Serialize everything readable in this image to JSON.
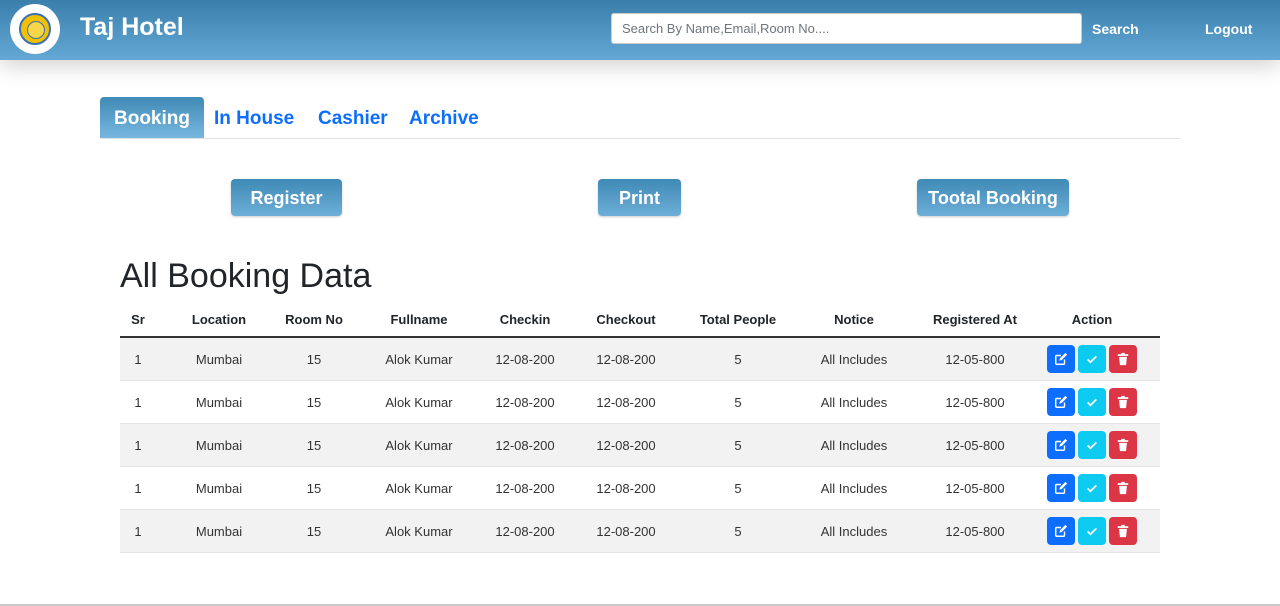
{
  "header": {
    "brand": "Taj Hotel",
    "search_placeholder": "Search By Name,Email,Room No....",
    "search_label": "Search",
    "logout_label": "Logout"
  },
  "tabs": [
    {
      "label": "Booking",
      "active": true
    },
    {
      "label": "In House",
      "active": false
    },
    {
      "label": "Cashier",
      "active": false
    },
    {
      "label": "Archive",
      "active": false
    }
  ],
  "actions": {
    "register": "Register",
    "print": "Print",
    "total": "Tootal Booking"
  },
  "heading": "All Booking Data",
  "table": {
    "columns": [
      "Sr",
      "Location",
      "Room No",
      "Fullname",
      "Checkin",
      "Checkout",
      "Total People",
      "Notice",
      "Registered At",
      "Action"
    ],
    "rows": [
      [
        "1",
        "Mumbai",
        "15",
        "Alok Kumar",
        "12-08-200",
        "12-08-200",
        "5",
        "All Includes",
        "12-05-800"
      ],
      [
        "1",
        "Mumbai",
        "15",
        "Alok Kumar",
        "12-08-200",
        "12-08-200",
        "5",
        "All Includes",
        "12-05-800"
      ],
      [
        "1",
        "Mumbai",
        "15",
        "Alok Kumar",
        "12-08-200",
        "12-08-200",
        "5",
        "All Includes",
        "12-05-800"
      ],
      [
        "1",
        "Mumbai",
        "15",
        "Alok Kumar",
        "12-08-200",
        "12-08-200",
        "5",
        "All Includes",
        "12-05-800"
      ],
      [
        "1",
        "Mumbai",
        "15",
        "Alok Kumar",
        "12-08-200",
        "12-08-200",
        "5",
        "All Includes",
        "12-05-800"
      ]
    ],
    "row_actions": [
      "edit-icon",
      "check-icon",
      "trash-icon"
    ]
  },
  "colors": {
    "header_gradient_top": "#3a7fab",
    "header_gradient_bottom": "#64a9d6",
    "link": "#0d6efd",
    "edit": "#0d6efd",
    "check": "#0dcaf0",
    "delete": "#dc3545"
  }
}
